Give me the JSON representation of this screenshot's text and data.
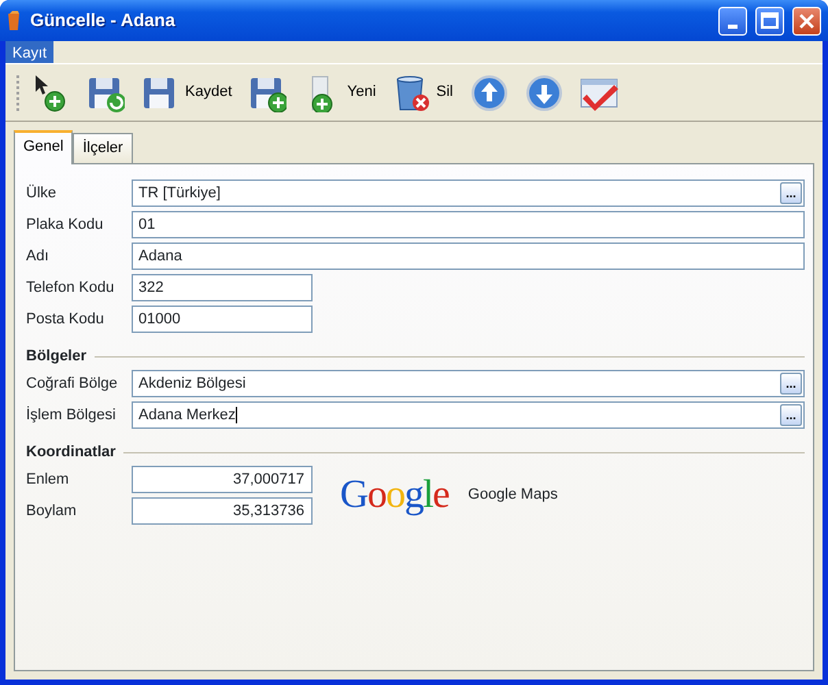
{
  "window": {
    "title": "Güncelle - Adana"
  },
  "menu": [
    {
      "label": "Kayıt",
      "selected": true
    }
  ],
  "toolbar": [
    {
      "kind": "add"
    },
    {
      "kind": "refresh"
    },
    {
      "kind": "save",
      "label": "Kaydet"
    },
    {
      "kind": "saveas"
    },
    {
      "kind": "new",
      "label": "Yeni"
    },
    {
      "kind": "delete",
      "label": "Sil"
    },
    {
      "kind": "up"
    },
    {
      "kind": "down"
    },
    {
      "kind": "confirm"
    }
  ],
  "tabs": [
    {
      "label": "Genel",
      "selected": true
    },
    {
      "label": "İlçeler",
      "selected": false
    }
  ],
  "sections": [
    {
      "fields": [
        {
          "label": "Ülke",
          "value": "TR [Türkiye]",
          "kind": "wide",
          "lookup": "..."
        },
        {
          "label": "Plaka Kodu",
          "value": "01",
          "kind": "wide"
        },
        {
          "label": "Adı",
          "value": "Adana",
          "kind": "wide"
        },
        {
          "label": "Telefon Kodu",
          "value": "322",
          "kind": "short"
        },
        {
          "label": "Posta Kodu",
          "value": "01000",
          "kind": "short"
        }
      ]
    },
    {
      "title": "Bölgeler",
      "fields": [
        {
          "label": "Coğrafi Bölge",
          "value": "Akdeniz Bölgesi",
          "kind": "wide",
          "lookup": "..."
        },
        {
          "label": "İşlem Bölgesi",
          "value": "Adana Merkez",
          "kind": "wide",
          "lookup": "...",
          "focused": true
        }
      ]
    },
    {
      "title": "Koordinatlar",
      "fields": [
        {
          "label": "Enlem",
          "value": "37,000717",
          "kind": "number"
        },
        {
          "label": "Boylam",
          "value": "35,313736",
          "kind": "number"
        }
      ],
      "map_link": {
        "logo": "Google",
        "label": "Google Maps"
      }
    }
  ]
}
